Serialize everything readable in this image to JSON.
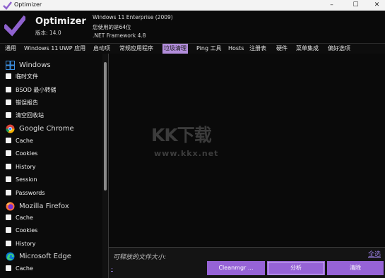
{
  "window": {
    "title": "Optimizer",
    "controls": {
      "minimize": "–",
      "maximize": "☐",
      "close": "✕"
    }
  },
  "header": {
    "app_name": "Optimizer",
    "version": "版本: 14.0",
    "sysinfo": [
      "Windows 11 Enterprise (2009)",
      "您使用的是64位",
      ".NET Framework 4.8"
    ]
  },
  "menu": {
    "items": [
      "通用",
      "Windows 11",
      "UWP 应用",
      "启动项",
      "常规应用程序",
      "垃圾清理",
      "Ping 工具",
      "Hosts",
      "注册表",
      "硬件",
      "菜单集成",
      "偏好选项"
    ],
    "active": "垃圾清理"
  },
  "sidebar": {
    "windows": {
      "label": "Windows",
      "items": [
        "临时文件",
        "BSOD 最小转储",
        "错误报告",
        "清空回收站"
      ]
    },
    "chrome": {
      "label": "Google Chrome",
      "items": [
        "Cache",
        "Cookies",
        "History",
        "Session",
        "Passwords"
      ]
    },
    "firefox": {
      "label": "Mozilla Firefox",
      "items": [
        "Cache",
        "Cookies",
        "History"
      ]
    },
    "edge": {
      "label": "Microsoft Edge",
      "items": [
        "Cache"
      ]
    }
  },
  "watermark": {
    "logo": "KK下载",
    "url": "www.kkx.net"
  },
  "bottom": {
    "size_label": "可释放的文件大小:",
    "size_value": "-",
    "select_all": "全选",
    "buttons": {
      "cleanmgr": "Cleanmgr ...",
      "analyze": "分析",
      "clean": "清除"
    }
  },
  "colors": {
    "accent": "#9663d6",
    "active_tab": "#b28ddb",
    "background": "#0a0a0a",
    "link": "#9b7fe6"
  }
}
